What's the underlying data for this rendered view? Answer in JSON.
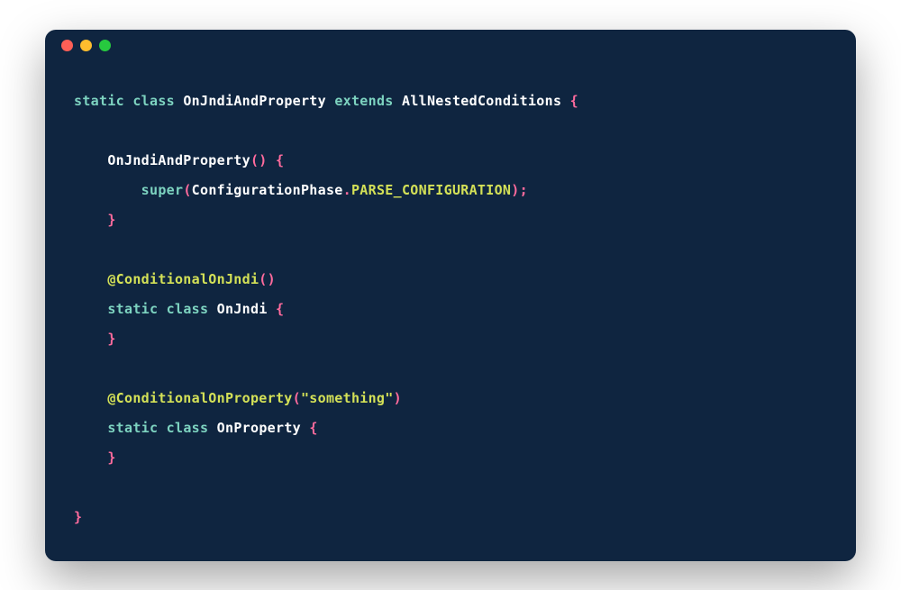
{
  "code": {
    "lines": [
      {
        "indent": 0,
        "tokens": [
          {
            "cls": "kw",
            "t": "static"
          },
          {
            "cls": "",
            "t": " "
          },
          {
            "cls": "kw",
            "t": "class"
          },
          {
            "cls": "",
            "t": " "
          },
          {
            "cls": "cls",
            "t": "OnJndiAndProperty"
          },
          {
            "cls": "",
            "t": " "
          },
          {
            "cls": "ext",
            "t": "extends"
          },
          {
            "cls": "",
            "t": " "
          },
          {
            "cls": "cls",
            "t": "AllNestedConditions"
          },
          {
            "cls": "",
            "t": " "
          },
          {
            "cls": "brace",
            "t": "{"
          }
        ]
      },
      {
        "indent": 0,
        "tokens": []
      },
      {
        "indent": 1,
        "tokens": [
          {
            "cls": "cls",
            "t": "OnJndiAndProperty"
          },
          {
            "cls": "paren",
            "t": "()"
          },
          {
            "cls": "",
            "t": " "
          },
          {
            "cls": "brace",
            "t": "{"
          }
        ]
      },
      {
        "indent": 2,
        "tokens": [
          {
            "cls": "fn",
            "t": "super"
          },
          {
            "cls": "paren",
            "t": "("
          },
          {
            "cls": "cls",
            "t": "ConfigurationPhase"
          },
          {
            "cls": "dot",
            "t": "."
          },
          {
            "cls": "const",
            "t": "PARSE_CONFIGURATION"
          },
          {
            "cls": "paren",
            "t": ")"
          },
          {
            "cls": "semi",
            "t": ";"
          }
        ]
      },
      {
        "indent": 1,
        "tokens": [
          {
            "cls": "brace",
            "t": "}"
          }
        ]
      },
      {
        "indent": 0,
        "tokens": []
      },
      {
        "indent": 1,
        "tokens": [
          {
            "cls": "anno",
            "t": "@ConditionalOnJndi"
          },
          {
            "cls": "paren",
            "t": "()"
          }
        ]
      },
      {
        "indent": 1,
        "tokens": [
          {
            "cls": "kw",
            "t": "static"
          },
          {
            "cls": "",
            "t": " "
          },
          {
            "cls": "kw",
            "t": "class"
          },
          {
            "cls": "",
            "t": " "
          },
          {
            "cls": "cls",
            "t": "OnJndi"
          },
          {
            "cls": "",
            "t": " "
          },
          {
            "cls": "brace",
            "t": "{"
          }
        ]
      },
      {
        "indent": 1,
        "tokens": [
          {
            "cls": "brace",
            "t": "}"
          }
        ]
      },
      {
        "indent": 0,
        "tokens": []
      },
      {
        "indent": 1,
        "tokens": [
          {
            "cls": "anno",
            "t": "@ConditionalOnProperty"
          },
          {
            "cls": "paren",
            "t": "("
          },
          {
            "cls": "str",
            "t": "\"something\""
          },
          {
            "cls": "paren",
            "t": ")"
          }
        ]
      },
      {
        "indent": 1,
        "tokens": [
          {
            "cls": "kw",
            "t": "static"
          },
          {
            "cls": "",
            "t": " "
          },
          {
            "cls": "kw",
            "t": "class"
          },
          {
            "cls": "",
            "t": " "
          },
          {
            "cls": "cls",
            "t": "OnProperty"
          },
          {
            "cls": "",
            "t": " "
          },
          {
            "cls": "brace",
            "t": "{"
          }
        ]
      },
      {
        "indent": 1,
        "tokens": [
          {
            "cls": "brace",
            "t": "}"
          }
        ]
      },
      {
        "indent": 0,
        "tokens": []
      },
      {
        "indent": 0,
        "tokens": [
          {
            "cls": "brace",
            "t": "}"
          }
        ]
      }
    ],
    "indentString": "    "
  }
}
